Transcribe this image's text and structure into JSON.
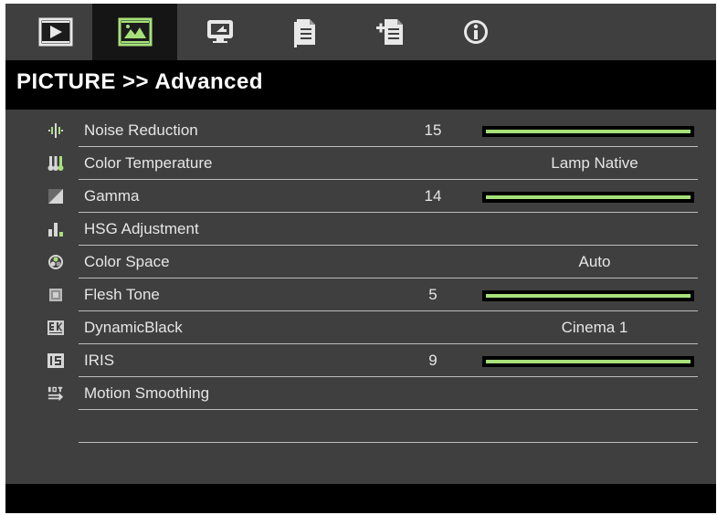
{
  "tabs": [
    {
      "name": "image-tab",
      "active": false
    },
    {
      "name": "picture-tab",
      "active": true
    },
    {
      "name": "display-tab",
      "active": false
    },
    {
      "name": "setup-tab",
      "active": false
    },
    {
      "name": "options-tab",
      "active": false
    },
    {
      "name": "info-tab",
      "active": false
    }
  ],
  "header": {
    "title": "PICTURE >> Advanced"
  },
  "menu": {
    "items": [
      {
        "label": "Noise Reduction",
        "value": "15",
        "level": 1.0,
        "icon": "noise-reduction-icon"
      },
      {
        "label": "Color Temperature",
        "value": "Lamp Native",
        "icon": "thermometer-icon"
      },
      {
        "label": "Gamma",
        "value": "14",
        "level": 1.0,
        "icon": "gamma-icon"
      },
      {
        "label": "HSG Adjustment",
        "value": "",
        "icon": "hsg-icon"
      },
      {
        "label": "Color Space",
        "value": "Auto",
        "icon": "color-space-icon"
      },
      {
        "label": "Flesh Tone",
        "value": "5",
        "level": 1.0,
        "icon": "flesh-tone-icon"
      },
      {
        "label": "DynamicBlack",
        "value": "Cinema 1",
        "icon": "dynamic-black-icon"
      },
      {
        "label": "IRIS",
        "value": "9",
        "level": 1.0,
        "icon": "iris-icon"
      },
      {
        "label": "Motion Smoothing",
        "value": "",
        "icon": "motion-smoothing-icon"
      }
    ]
  },
  "colors": {
    "bar_fill": "#a6e07a",
    "background": "#3f3f3f",
    "title_bg": "#000000"
  }
}
